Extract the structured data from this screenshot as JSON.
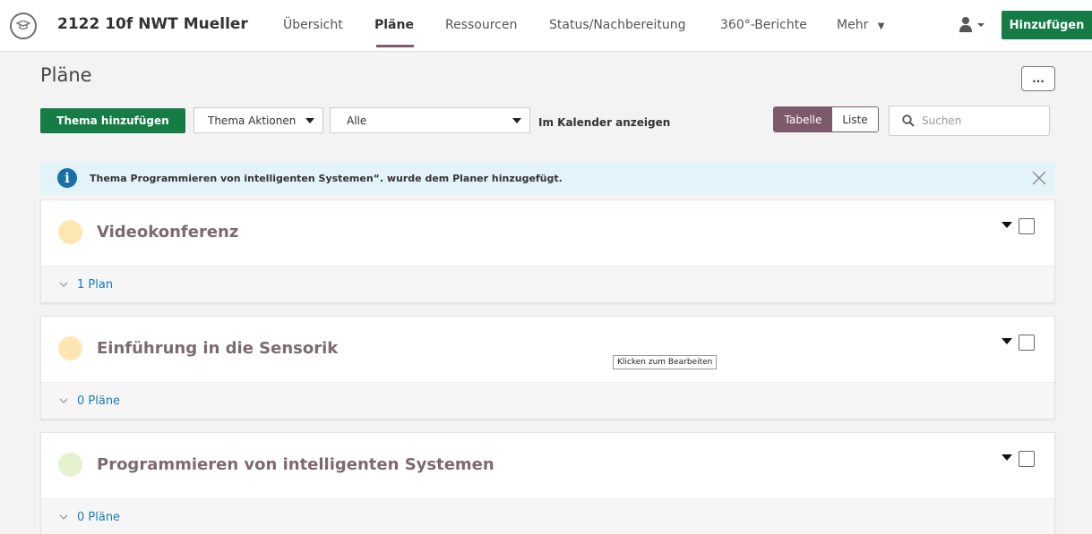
{
  "header": {
    "course_title": "2122 10f NWT Mueller",
    "nav": [
      "Übersicht",
      "Pläne",
      "Ressourcen",
      "Status/Nachbereitung",
      "360°-Berichte",
      "Mehr"
    ],
    "active_nav": "Pläne",
    "add_button": "Hinzufügen"
  },
  "page": {
    "title": "Pläne",
    "more_button": "..."
  },
  "toolbar": {
    "add_topic": "Thema hinzufügen",
    "topic_actions": "Thema Aktionen",
    "filter_value": "Alle",
    "calendar_link": "Im Kalender anzeigen",
    "view_table": "Tabelle",
    "view_list": "Liste",
    "active_view": "Tabelle",
    "search_placeholder": "Suchen"
  },
  "alert": {
    "message": "Thema Programmieren von intelligenten Systemen“. wurde dem Planer hinzugefügt."
  },
  "topics": [
    {
      "title": "Videokonferenz",
      "plans": "1 Plan",
      "color": "#fde6b2"
    },
    {
      "title": "Einführung in die Sensorik",
      "plans": "0 Pläne",
      "color": "#fde6b2"
    },
    {
      "title": "Programmieren von intelligenten Systemen",
      "plans": "0 Pläne",
      "color": "#e6f2cf"
    }
  ],
  "tooltip": "Klicken zum Bearbeiten",
  "colors": {
    "primary_green": "#157c45",
    "accent_mauve": "#7c5a6b",
    "link_blue": "#1a7bb9",
    "info_blue": "#1a6fa8"
  }
}
